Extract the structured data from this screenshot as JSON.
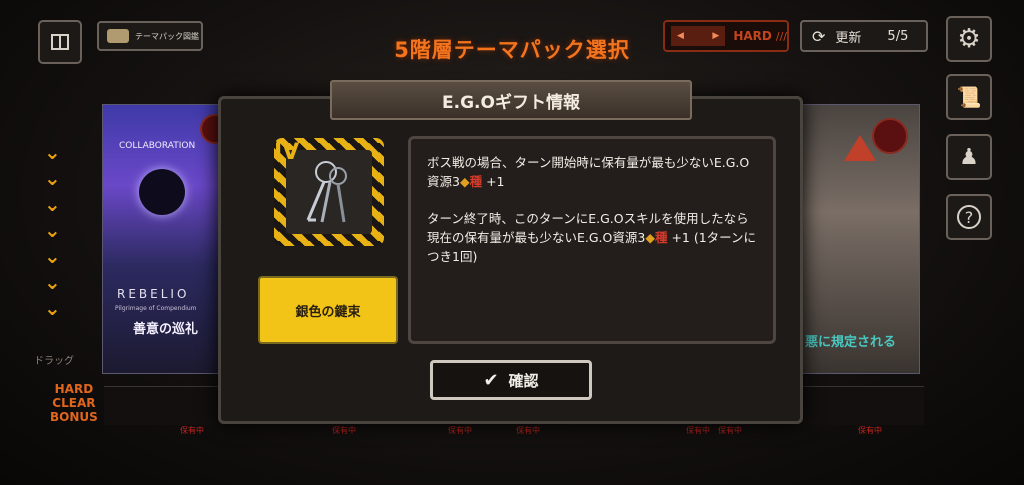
{
  "screen": {
    "title": "5階層テーマパック選択",
    "pack_button_label": "テーマパック図鑑",
    "difficulty_label": "HARD",
    "refresh_label": "更新",
    "refresh_count": "5/5",
    "drag_label": "ドラッグ",
    "hard_bonus_lines": [
      "HARD",
      "CLEAR",
      "BONUS"
    ],
    "left_card": {
      "header": "COLLABORATION",
      "title_line": "REBELIO",
      "subtitle": "Pilgrimage of Compendium",
      "name": "善意の巡礼"
    },
    "right_card": {
      "name": "悪に規定される"
    },
    "gift_tags": [
      "保有中",
      "保有中",
      "保有中",
      "保有中",
      "保有中",
      "保有中",
      "保有中"
    ]
  },
  "modal": {
    "header": "E.G.Oギフト情報",
    "tier": "IV",
    "gift_name": "銀色の鍵束",
    "description": [
      {
        "a": "ボス戦の場合、ターン開始時に保有量が最も少ないE.G.O資源3",
        "res": "種",
        "b": " +1"
      },
      {
        "a": "ターン終了時、このターンにE.G.Oスキルを使用したなら現在の保有量が最も少ないE.G.O資源3",
        "res": "種",
        "b": " +1 (1ターンにつき1回)"
      }
    ],
    "confirm_label": "確認"
  },
  "colors": {
    "title": "#f4741e",
    "gift_name_bg": "#f2c418",
    "resource_text": "#d23a2a",
    "hard_accent": "#c4441e"
  },
  "icons": {
    "menu": "book-icon",
    "settings": "gear-icon",
    "scroll": "scroll-icon",
    "figure": "pawn-icon",
    "help": "question-icon",
    "refresh": "refresh-icon",
    "check": "check-icon",
    "gift": "keys-icon"
  }
}
